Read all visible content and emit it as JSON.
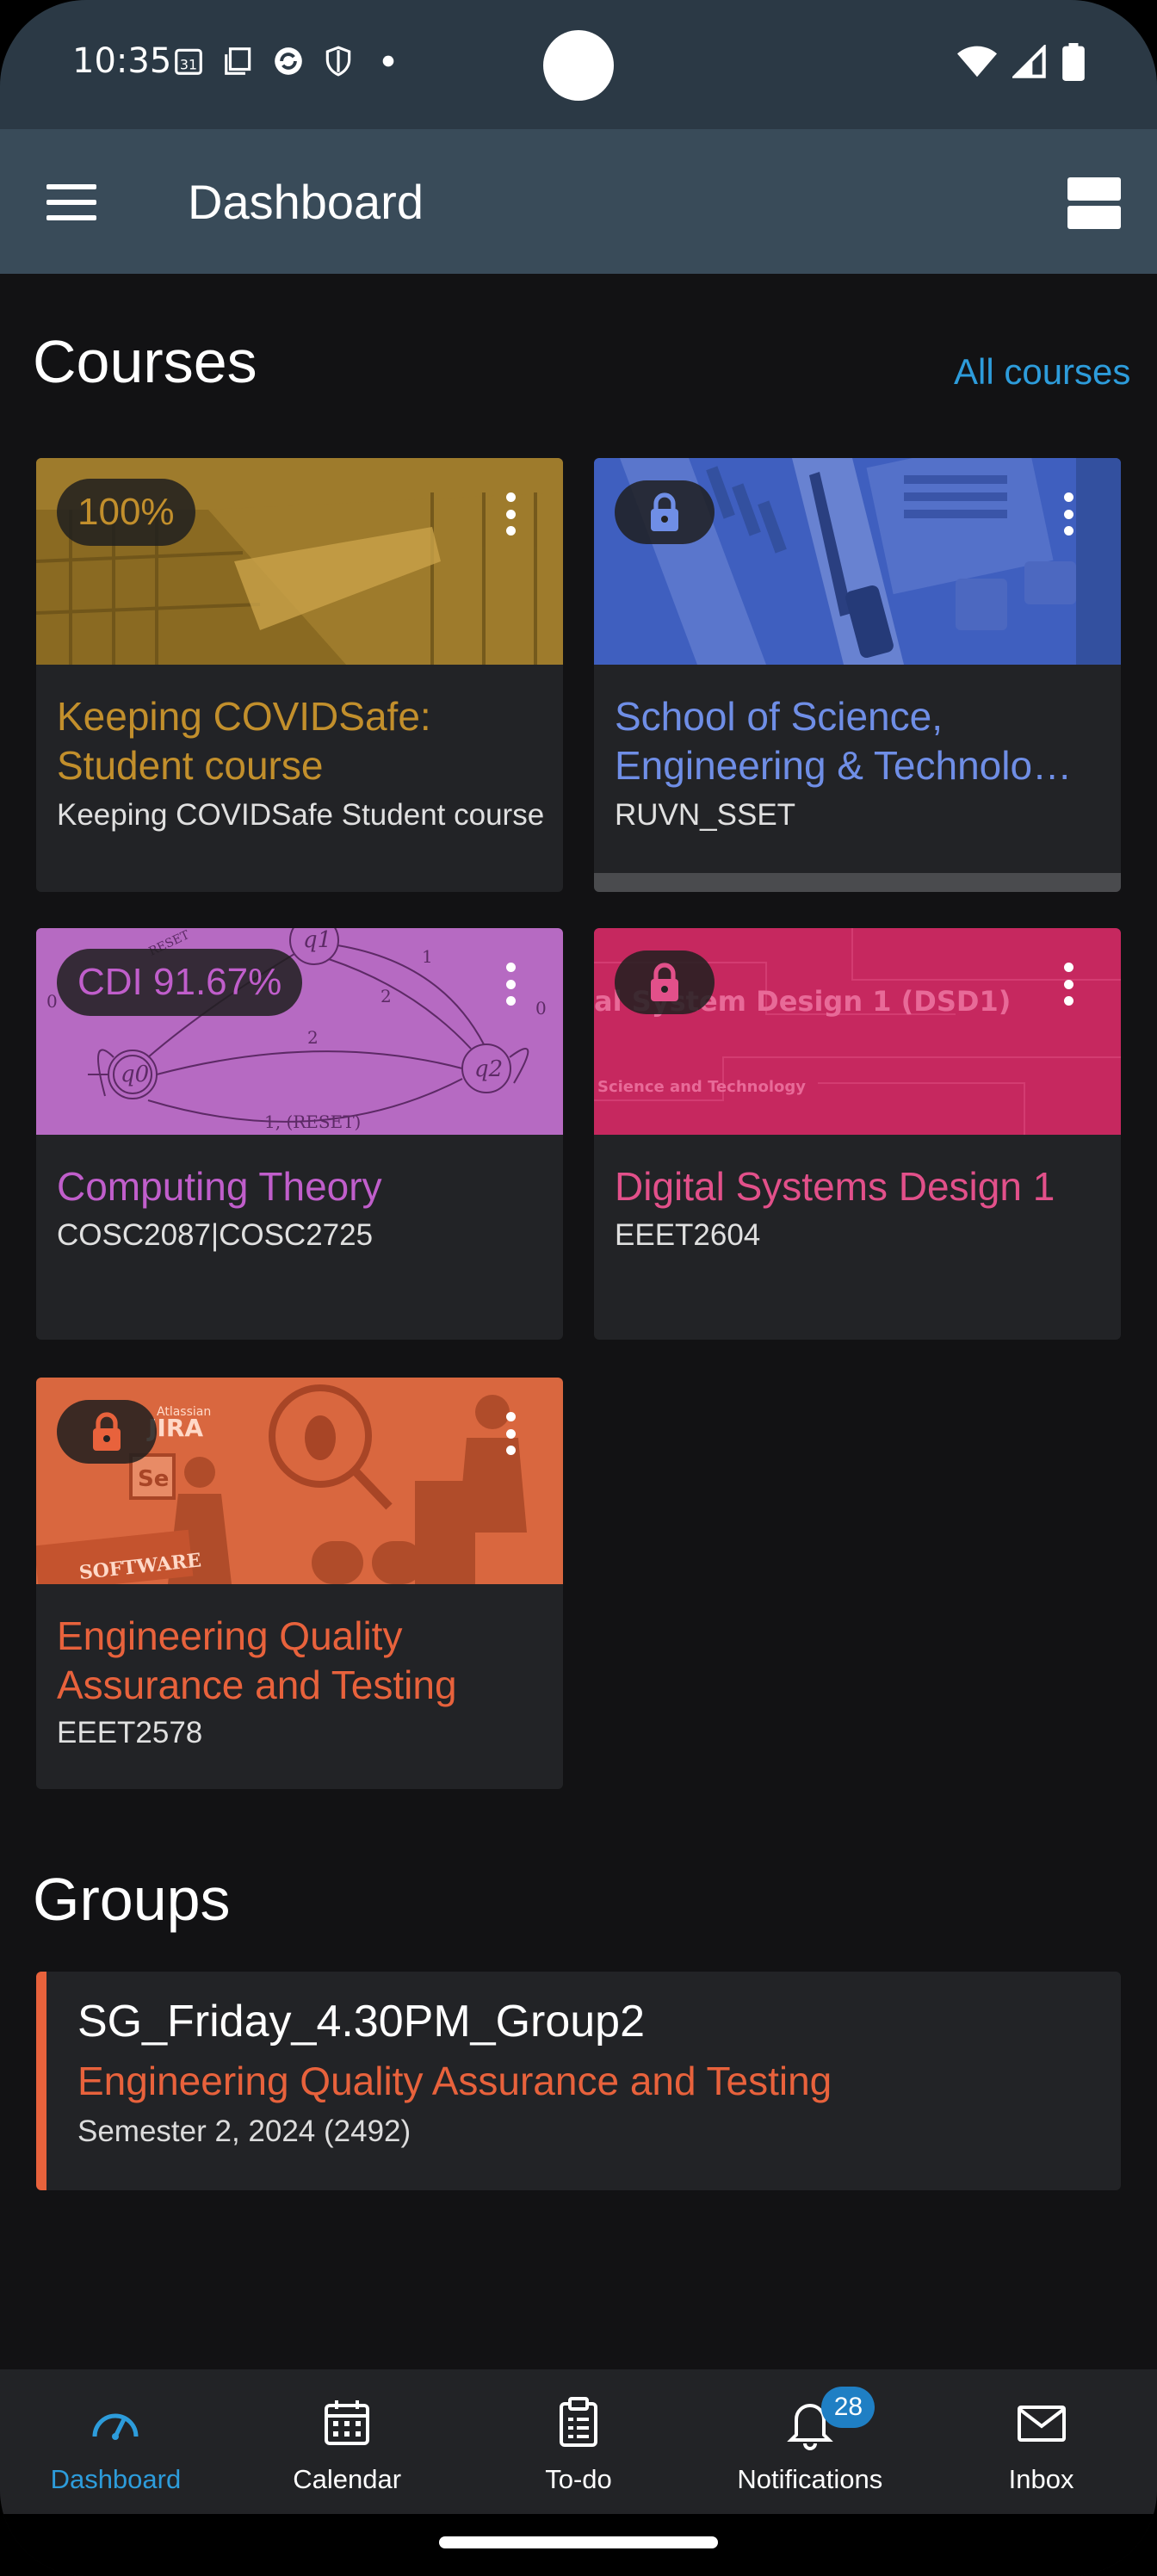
{
  "status_bar": {
    "time": "10:35",
    "left_icons": [
      "calendar-icon",
      "screen-icon",
      "sync-icon",
      "shield-icon",
      "dot-icon"
    ],
    "right_icons": [
      "wifi-icon",
      "signal-icon",
      "battery-icon"
    ]
  },
  "app_bar": {
    "title": "Dashboard",
    "menu_icon": "hamburger-menu-icon",
    "layout_icon": "grid-layout-icon"
  },
  "courses_section": {
    "title": "Courses",
    "all_courses_label": "All courses",
    "cards": [
      {
        "badge": "100%",
        "locked": false,
        "title": "Keeping COVIDSafe: Student course",
        "subtitle": "Keeping COVIDSafe Student course",
        "color": "#c28f2c",
        "image_color": "#8a6a22"
      },
      {
        "badge": "",
        "locked": true,
        "title": "School of Science, Engineering & Technolo…",
        "subtitle": "RUVN_SSET",
        "color": "#6f8ee6",
        "image_color": "#3f5fbf",
        "progress": 0
      },
      {
        "badge": "CDI 91.67%",
        "locked": false,
        "title": "Computing Theory",
        "subtitle": "COSC2087|COSC2725",
        "color": "#c05ecb",
        "image_color": "#b66ac2",
        "image_text": [
          "q1",
          "q0",
          "q2",
          "1",
          "2",
          "2",
          "0",
          "0",
          "1, (RESET)",
          "RESET"
        ]
      },
      {
        "badge": "",
        "locked": true,
        "title": "Digital Systems Design 1",
        "subtitle": "EEET2604",
        "color": "#e2508a",
        "image_color": "#c6285f",
        "image_text": [
          "al System Design 1 (DSD1)",
          "Science and Technology"
        ]
      },
      {
        "badge": "",
        "locked": true,
        "title": "Engineering Quality Assurance and Testing",
        "subtitle": "EEET2578",
        "color": "#e8623c",
        "image_color": "#d9673f",
        "image_text": [
          "Atlassian",
          "JIRA",
          "Se",
          "SOFTWARE"
        ]
      }
    ]
  },
  "groups_section": {
    "title": "Groups",
    "groups": [
      {
        "name": "SG_Friday_4.30PM_Group2",
        "course": "Engineering Quality Assurance and Testing",
        "term": "Semester 2, 2024 (2492)",
        "color": "#e8623c"
      }
    ]
  },
  "bottom_nav": {
    "items": [
      {
        "label": "Dashboard",
        "icon": "dashboard-gauge-icon",
        "active": true
      },
      {
        "label": "Calendar",
        "icon": "calendar-icon",
        "active": false
      },
      {
        "label": "To-do",
        "icon": "clipboard-icon",
        "active": false
      },
      {
        "label": "Notifications",
        "icon": "bell-icon",
        "active": false,
        "badge": "28"
      },
      {
        "label": "Inbox",
        "icon": "envelope-icon",
        "active": false
      }
    ]
  },
  "colors": {
    "accent": "#2d9cdb",
    "background": "#121214",
    "card": "#222326",
    "app_bar": "#394b59",
    "status_bar": "#2b3945"
  }
}
